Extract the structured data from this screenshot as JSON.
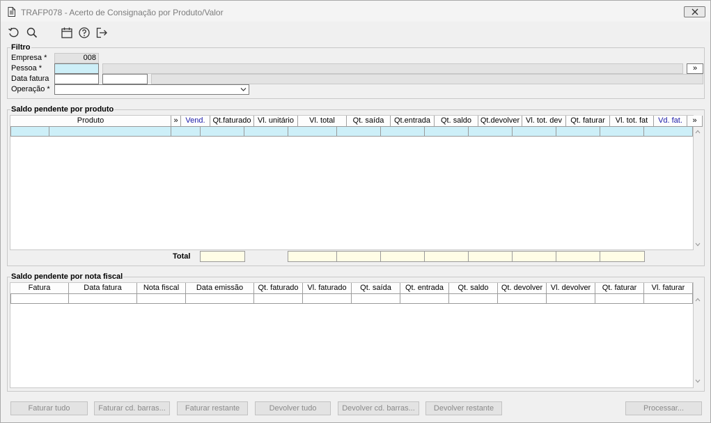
{
  "window": {
    "title": "TRAFP078 - Acerto de Consignação por Produto/Valor",
    "close_label": "close"
  },
  "toolbar": {
    "icons": [
      "refresh-icon",
      "search-icon",
      "calendar-icon",
      "help-icon",
      "exit-icon"
    ]
  },
  "filtro": {
    "legend": "Filtro",
    "empresa_label": "Empresa *",
    "empresa_value": "008",
    "pessoa_label": "Pessoa *",
    "pessoa_value": "",
    "pessoa_lookup_label": "»",
    "data_fatura_label": "Data fatura",
    "data_fatura_from": "",
    "data_fatura_to": "",
    "operacao_label": "Operação *",
    "operacao_value": ""
  },
  "produto_grid": {
    "legend": "Saldo pendente por produto",
    "columns": [
      "Produto",
      "»",
      "Vend.",
      "Qt.faturado",
      "Vl. unitário",
      "Vl. total",
      "Qt. saída",
      "Qt.entrada",
      "Qt. saldo",
      "Qt.devolver",
      "Vl. tot. dev",
      "Qt. faturar",
      "Vl. tot. fat",
      "Vd. fat.",
      "»"
    ],
    "total_label": "Total"
  },
  "nota_grid": {
    "legend": "Saldo pendente por nota fiscal",
    "columns": [
      "Fatura",
      "Data fatura",
      "Nota fiscal",
      "Data emissão",
      "Qt. faturado",
      "Vl. faturado",
      "Qt. saída",
      "Qt. entrada",
      "Qt. saldo",
      "Qt. devolver",
      "Vl. devolver",
      "Qt. faturar",
      "Vl. faturar"
    ]
  },
  "actions": {
    "faturar_tudo": "Faturar tudo",
    "faturar_cd_barras": "Faturar cd. barras...",
    "faturar_restante": "Faturar restante",
    "devolver_tudo": "Devolver tudo",
    "devolver_cd_barras": "Devolver cd. barras...",
    "devolver_restante": "Devolver restante",
    "processar": "Processar..."
  },
  "colors": {
    "required_field": "#cdeff8",
    "totals_cell": "#fffde6",
    "link_header": "#1a1aa8",
    "disabled_text": "#8a8a8a"
  }
}
